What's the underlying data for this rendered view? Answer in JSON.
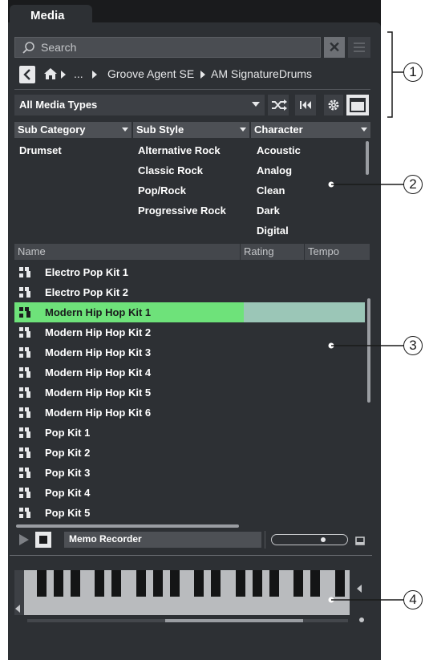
{
  "tab": {
    "label": "Media"
  },
  "search": {
    "placeholder": "Search"
  },
  "breadcrumb": {
    "ellipsis": "...",
    "items": [
      "Groove Agent SE",
      "AM SignatureDrums"
    ]
  },
  "media_type": {
    "selected": "All Media Types"
  },
  "filters": {
    "columns": [
      {
        "header": "Sub Category",
        "values": [
          "Drumset"
        ]
      },
      {
        "header": "Sub Style",
        "values": [
          "Alternative Rock",
          "Classic Rock",
          "Pop/Rock",
          "Progressive Rock"
        ]
      },
      {
        "header": "Character",
        "values": [
          "Acoustic",
          "Analog",
          "Clean",
          "Dark",
          "Digital"
        ]
      }
    ]
  },
  "results": {
    "columns": [
      "Name",
      "Rating",
      "Tempo"
    ],
    "rows": [
      "Electro Pop Kit 1",
      "Electro Pop Kit 2",
      "Modern Hip Hop Kit 1",
      "Modern Hip Hop Kit 2",
      "Modern Hip Hop Kit 3",
      "Modern Hip Hop Kit 4",
      "Modern Hip Hop Kit 5",
      "Modern Hip Hop Kit 6",
      "Pop Kit 1",
      "Pop Kit 2",
      "Pop Kit 3",
      "Pop Kit 4",
      "Pop Kit 5"
    ],
    "selected_index": 2
  },
  "transport": {
    "recorder_label": "Memo Recorder"
  },
  "callouts": [
    "1",
    "2",
    "3",
    "4"
  ],
  "colors": {
    "selection": "#6ee27a",
    "panel": "#2d3034"
  }
}
